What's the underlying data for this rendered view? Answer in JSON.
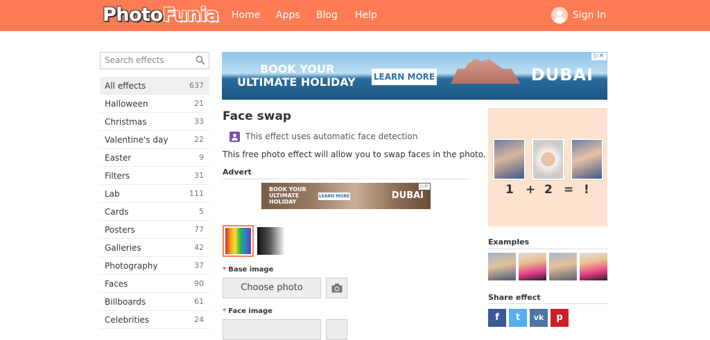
{
  "header": {
    "logo": {
      "part1": "Photo",
      "part2": "Funia"
    },
    "nav": [
      "Home",
      "Apps",
      "Blog",
      "Help"
    ],
    "signin": "Sign In"
  },
  "sidebar": {
    "search_placeholder": "Search effects",
    "categories": [
      {
        "label": "All effects",
        "count": "637"
      },
      {
        "label": "Halloween",
        "count": "21"
      },
      {
        "label": "Christmas",
        "count": "33"
      },
      {
        "label": "Valentine's day",
        "count": "22"
      },
      {
        "label": "Easter",
        "count": "9"
      },
      {
        "label": "Filters",
        "count": "31"
      },
      {
        "label": "Lab",
        "count": "111"
      },
      {
        "label": "Cards",
        "count": "5"
      },
      {
        "label": "Posters",
        "count": "77"
      },
      {
        "label": "Galleries",
        "count": "42"
      },
      {
        "label": "Photography",
        "count": "37"
      },
      {
        "label": "Faces",
        "count": "90"
      },
      {
        "label": "Billboards",
        "count": "61"
      },
      {
        "label": "Celebrities",
        "count": "24"
      }
    ]
  },
  "ad_top": {
    "line1": "BOOK YOUR",
    "line2": "ULTIMATE HOLIDAY",
    "button": "LEARN MORE",
    "brand": "DUBAI"
  },
  "main": {
    "title": "Face swap",
    "face_detection": "This effect uses automatic face detection",
    "description": "This free photo effect will allow you to swap faces in the photo.",
    "advert_label": "Advert",
    "ad_small": {
      "line1": "BOOK YOUR",
      "line2": "ULTIMATE",
      "line3": "HOLIDAY",
      "button": "LEARN MORE",
      "brand": "DUBAI"
    },
    "base_image_label": "Base image",
    "face_image_label": "Face image",
    "choose_photo": "Choose photo"
  },
  "right": {
    "equation": [
      "1",
      "+",
      "2",
      "=",
      "!"
    ],
    "examples_label": "Examples",
    "share_label": "Share effect",
    "share_buttons": [
      "f",
      "t",
      "vk",
      "p"
    ]
  },
  "colors": {
    "brand": "#ff7b53",
    "facebook": "#3b5998",
    "twitter": "#55acee",
    "vk": "#4c75a3",
    "pinterest": "#cb2027"
  }
}
